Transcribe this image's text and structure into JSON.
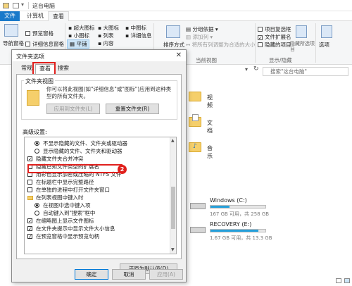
{
  "window": {
    "title": "这台电脑"
  },
  "ribbon": {
    "tabs": [
      "文件",
      "计算机",
      "查看"
    ],
    "nav_pane": "导航窗格",
    "preview_pane": "预览窗格",
    "details_pane": "详细信息窗格",
    "layout": [
      "超大图标",
      "大图标",
      "中图标",
      "小图标",
      "列表",
      "详细信息",
      "平铺",
      "内容"
    ],
    "group_by": "分组依据",
    "add_columns": "添加列",
    "size_all_columns": "将所有列调整为合适的大小",
    "sort_by": "排序方式",
    "current_view": "当前视图",
    "item_checkboxes": "项目复选框",
    "file_extensions": "文件扩展名",
    "hidden_items": "隐藏的项目",
    "hide_selected": "隐藏所选项目",
    "show_hide": "显示/隐藏",
    "options": "选项"
  },
  "search": {
    "placeholder": "搜索\"这台电脑\""
  },
  "explorer": {
    "folders": [
      "视频",
      "文档",
      "音乐"
    ],
    "drives": [
      {
        "name": "Windows (C:)",
        "free": "167 GB 可用，共 258 GB",
        "used_fraction": 0.35
      },
      {
        "name": "RECOVERY (E:)",
        "free": "1.67 GB 可用，共 13.3 GB",
        "used_fraction": 0.87
      }
    ]
  },
  "dialog": {
    "title": "文件夹选项",
    "tabs": [
      "常规",
      "查看",
      "搜索"
    ],
    "folder_view": {
      "legend": "文件夹视图",
      "desc": "你可以将此视图(如\"详细信息\"或\"图标\")应用到这种类型的所有文件夹。",
      "apply_btn": "应用到文件夹(L)",
      "reset_btn": "重置文件夹(R)"
    },
    "advanced_label": "高级设置:",
    "tree": [
      {
        "kind": "radio",
        "checked": true,
        "indent": 1,
        "text": "不显示隐藏的文件、文件夹或驱动器"
      },
      {
        "kind": "radio",
        "checked": false,
        "indent": 1,
        "text": "显示隐藏的文件、文件夹和驱动器"
      },
      {
        "kind": "check",
        "checked": true,
        "indent": 0,
        "text": "隐藏文件夹合并冲突"
      },
      {
        "kind": "check",
        "checked": false,
        "indent": 0,
        "text": "隐藏已知文件类型的扩展名"
      },
      {
        "kind": "check",
        "checked": false,
        "indent": 0,
        "text": "用彩色显示加密或压缩的 NTFS 文件"
      },
      {
        "kind": "check",
        "checked": false,
        "indent": 0,
        "text": "在标题栏中显示完整路径"
      },
      {
        "kind": "check",
        "checked": false,
        "indent": 0,
        "text": "在单独的进程中打开文件夹窗口"
      },
      {
        "kind": "folder",
        "checked": false,
        "indent": 0,
        "text": "在列表视图中键入时"
      },
      {
        "kind": "radio",
        "checked": true,
        "indent": 1,
        "text": "在视图中选中键入项"
      },
      {
        "kind": "radio",
        "checked": false,
        "indent": 1,
        "text": "自动键入到\"搜索\"框中"
      },
      {
        "kind": "check",
        "checked": true,
        "indent": 0,
        "text": "在缩略图上显示文件图标"
      },
      {
        "kind": "check",
        "checked": true,
        "indent": 0,
        "text": "在文件夹提示中显示文件大小信息"
      },
      {
        "kind": "check",
        "checked": true,
        "indent": 0,
        "text": "在预览窗格中显示预览句柄"
      }
    ],
    "restore_btn": "还原为默认值(D)",
    "ok_btn": "确定",
    "cancel_btn": "取消",
    "apply_btn": "应用(A)"
  },
  "annotations": {
    "badge1": "1",
    "badge2": "2",
    "color": "#e0201d"
  }
}
